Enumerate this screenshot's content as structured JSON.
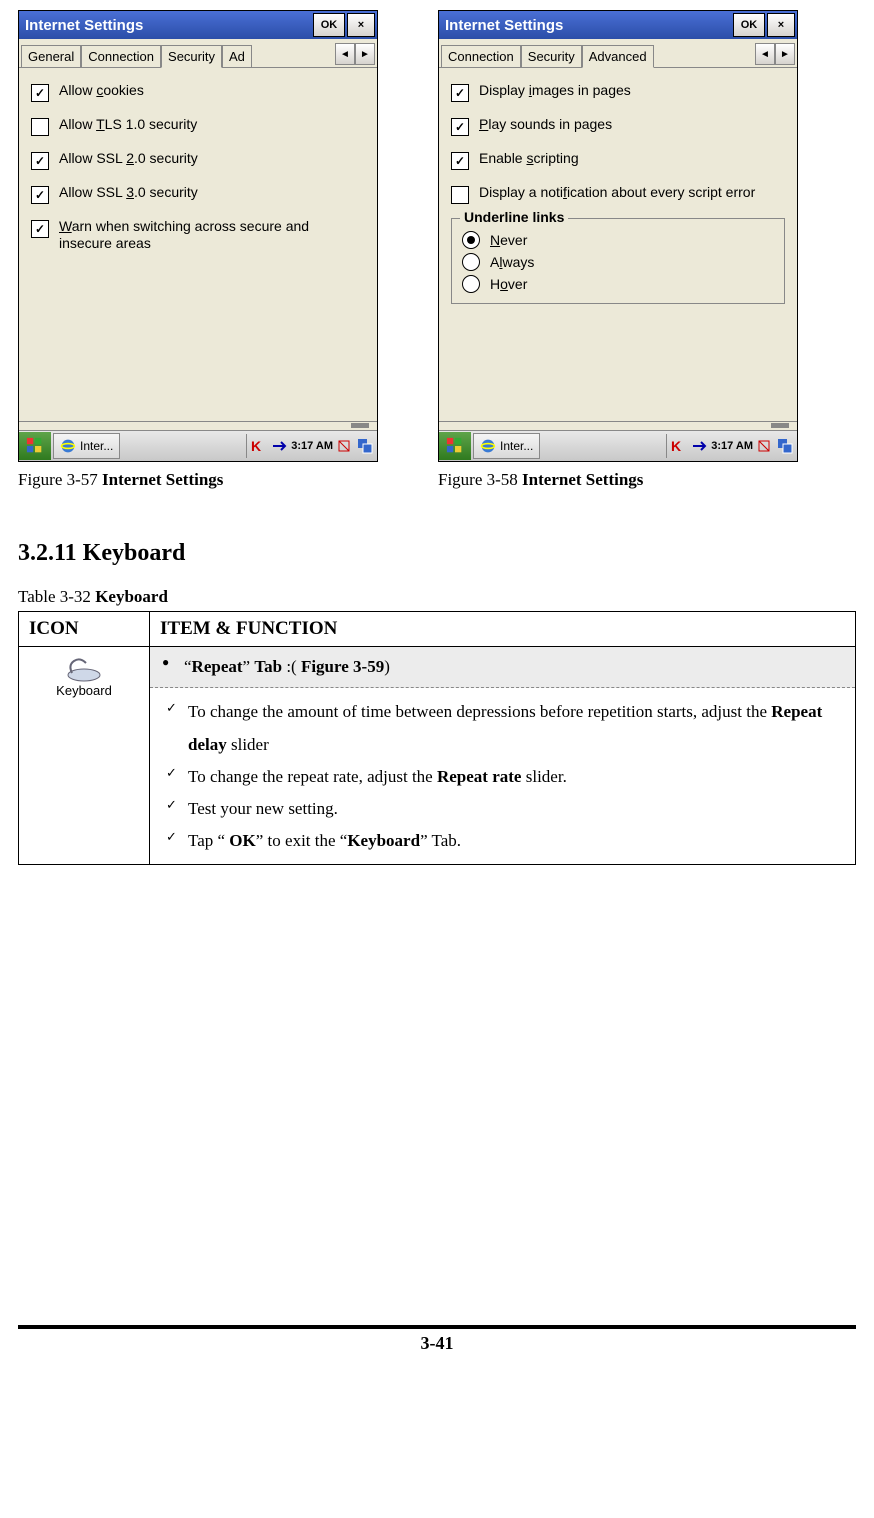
{
  "fig_left": {
    "title": "Internet Settings",
    "ok": "OK",
    "close": "×",
    "tabs": {
      "general": "General",
      "connection": "Connection",
      "security": "Security",
      "advanced_trunc": "Ad"
    },
    "opts": {
      "cookies": "Allow cookies",
      "tls": "Allow TLS 1.0 security",
      "ssl2": "Allow SSL 2.0 security",
      "ssl3": "Allow SSL 3.0 security",
      "warn": "Warn when switching across secure and insecure areas"
    },
    "taskbar": {
      "app": "Inter...",
      "time": "3:17 AM"
    },
    "caption_a": "Figure 3-57 ",
    "caption_b": "Internet Settings"
  },
  "fig_right": {
    "title": "Internet Settings",
    "ok": "OK",
    "close": "×",
    "tabs": {
      "connection": "Connection",
      "security": "Security",
      "advanced": "Advanced"
    },
    "opts": {
      "images": "Display images in pages",
      "sounds": "Play sounds in pages",
      "scripting": "Enable scripting",
      "notif": "Display a notification about every script error"
    },
    "group": "Underline links",
    "radio": {
      "never": "Never",
      "always": "Always",
      "hover": "Hover"
    },
    "taskbar": {
      "app": "Inter...",
      "time": "3:17 AM"
    },
    "caption_a": "Figure 3-58 ",
    "caption_b": "Internet Settings"
  },
  "section_heading": "3.2.11 Keyboard",
  "table": {
    "caption_a": "Table 3-32 ",
    "caption_b": "Keyboard",
    "h_icon": "ICON",
    "h_func": "ITEM & FUNCTION",
    "icon_label": "Keyboard",
    "tab_line": "\"Repeat\" Tab :( Figure 3-59)",
    "li1": "To change the amount of time between depressions before repetition starts, adjust the Repeat delay slider",
    "li2": "To change the repeat rate, adjust the Repeat rate slider.",
    "li3": "Test your new setting.",
    "li4": "Tap \" OK\" to exit the \"Keyboard\" Tab."
  },
  "page_number": "3-41"
}
